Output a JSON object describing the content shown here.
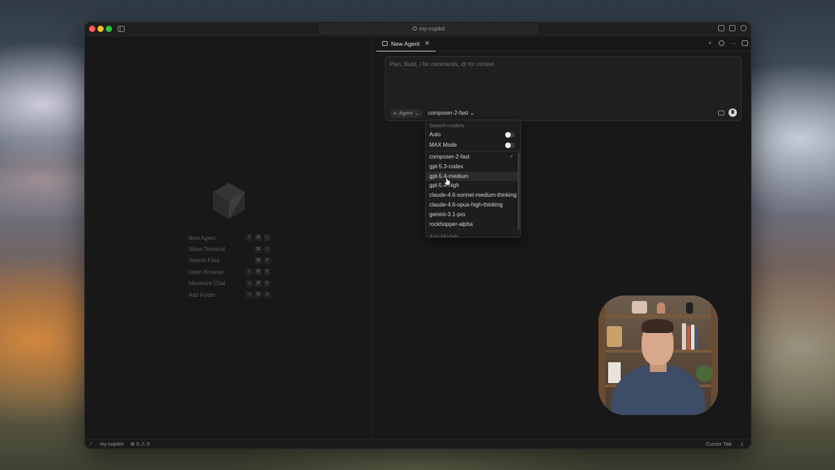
{
  "window": {
    "search_title": "my-copilot"
  },
  "left_pane": {
    "commands": [
      {
        "label": "New Agent",
        "keys": [
          "⇧",
          "⌘",
          "L"
        ]
      },
      {
        "label": "Show Terminal",
        "keys": [
          "⌘",
          "J"
        ]
      },
      {
        "label": "Search Files",
        "keys": [
          "⌘",
          "P"
        ]
      },
      {
        "label": "Open Browser",
        "keys": [
          "⇧",
          "⌘",
          "B"
        ]
      },
      {
        "label": "Maximize Chat",
        "keys": [
          "⌥",
          "⌘",
          "E"
        ]
      },
      {
        "label": "Add Folder",
        "keys": [
          "⌥",
          "⌘",
          "A"
        ]
      }
    ]
  },
  "right_pane": {
    "tab_label": "New Agent",
    "tab_close": "✕",
    "composer": {
      "placeholder": "Plan, Build, / for commands, @ for context",
      "agent_label": "Agent",
      "model_label": "composer-2-fast"
    },
    "actions": {
      "plus": "+",
      "more": "···"
    }
  },
  "model_dropdown": {
    "search_placeholder": "Search models",
    "toggles": [
      {
        "label": "Auto",
        "enabled": false
      },
      {
        "label": "MAX Mode",
        "enabled": false
      }
    ],
    "models": [
      {
        "label": "composer-2-fast",
        "selected": true
      },
      {
        "label": "gpt-5.3-codex",
        "selected": false
      },
      {
        "label": "gpt-5.4-medium",
        "selected": false,
        "hover": true
      },
      {
        "label": "gpt-5.4-high",
        "selected": false
      },
      {
        "label": "claude-4.6-sonnet-medium-thinking",
        "selected": false
      },
      {
        "label": "claude-4.6-opus-high-thinking",
        "selected": false
      },
      {
        "label": "gemini-3.1-pro",
        "selected": false
      },
      {
        "label": "rockhopper-alpha",
        "selected": false
      }
    ],
    "check_glyph": "✓",
    "add_label": "Add Models"
  },
  "statusbar": {
    "project": "my-copilot",
    "errors": "0",
    "warnings": "0",
    "right_label": "Cursor Tab"
  },
  "colors": {
    "window_bg": "#181818",
    "close": "#ff5f57",
    "minimize": "#febc2e",
    "maximize": "#28c840"
  }
}
